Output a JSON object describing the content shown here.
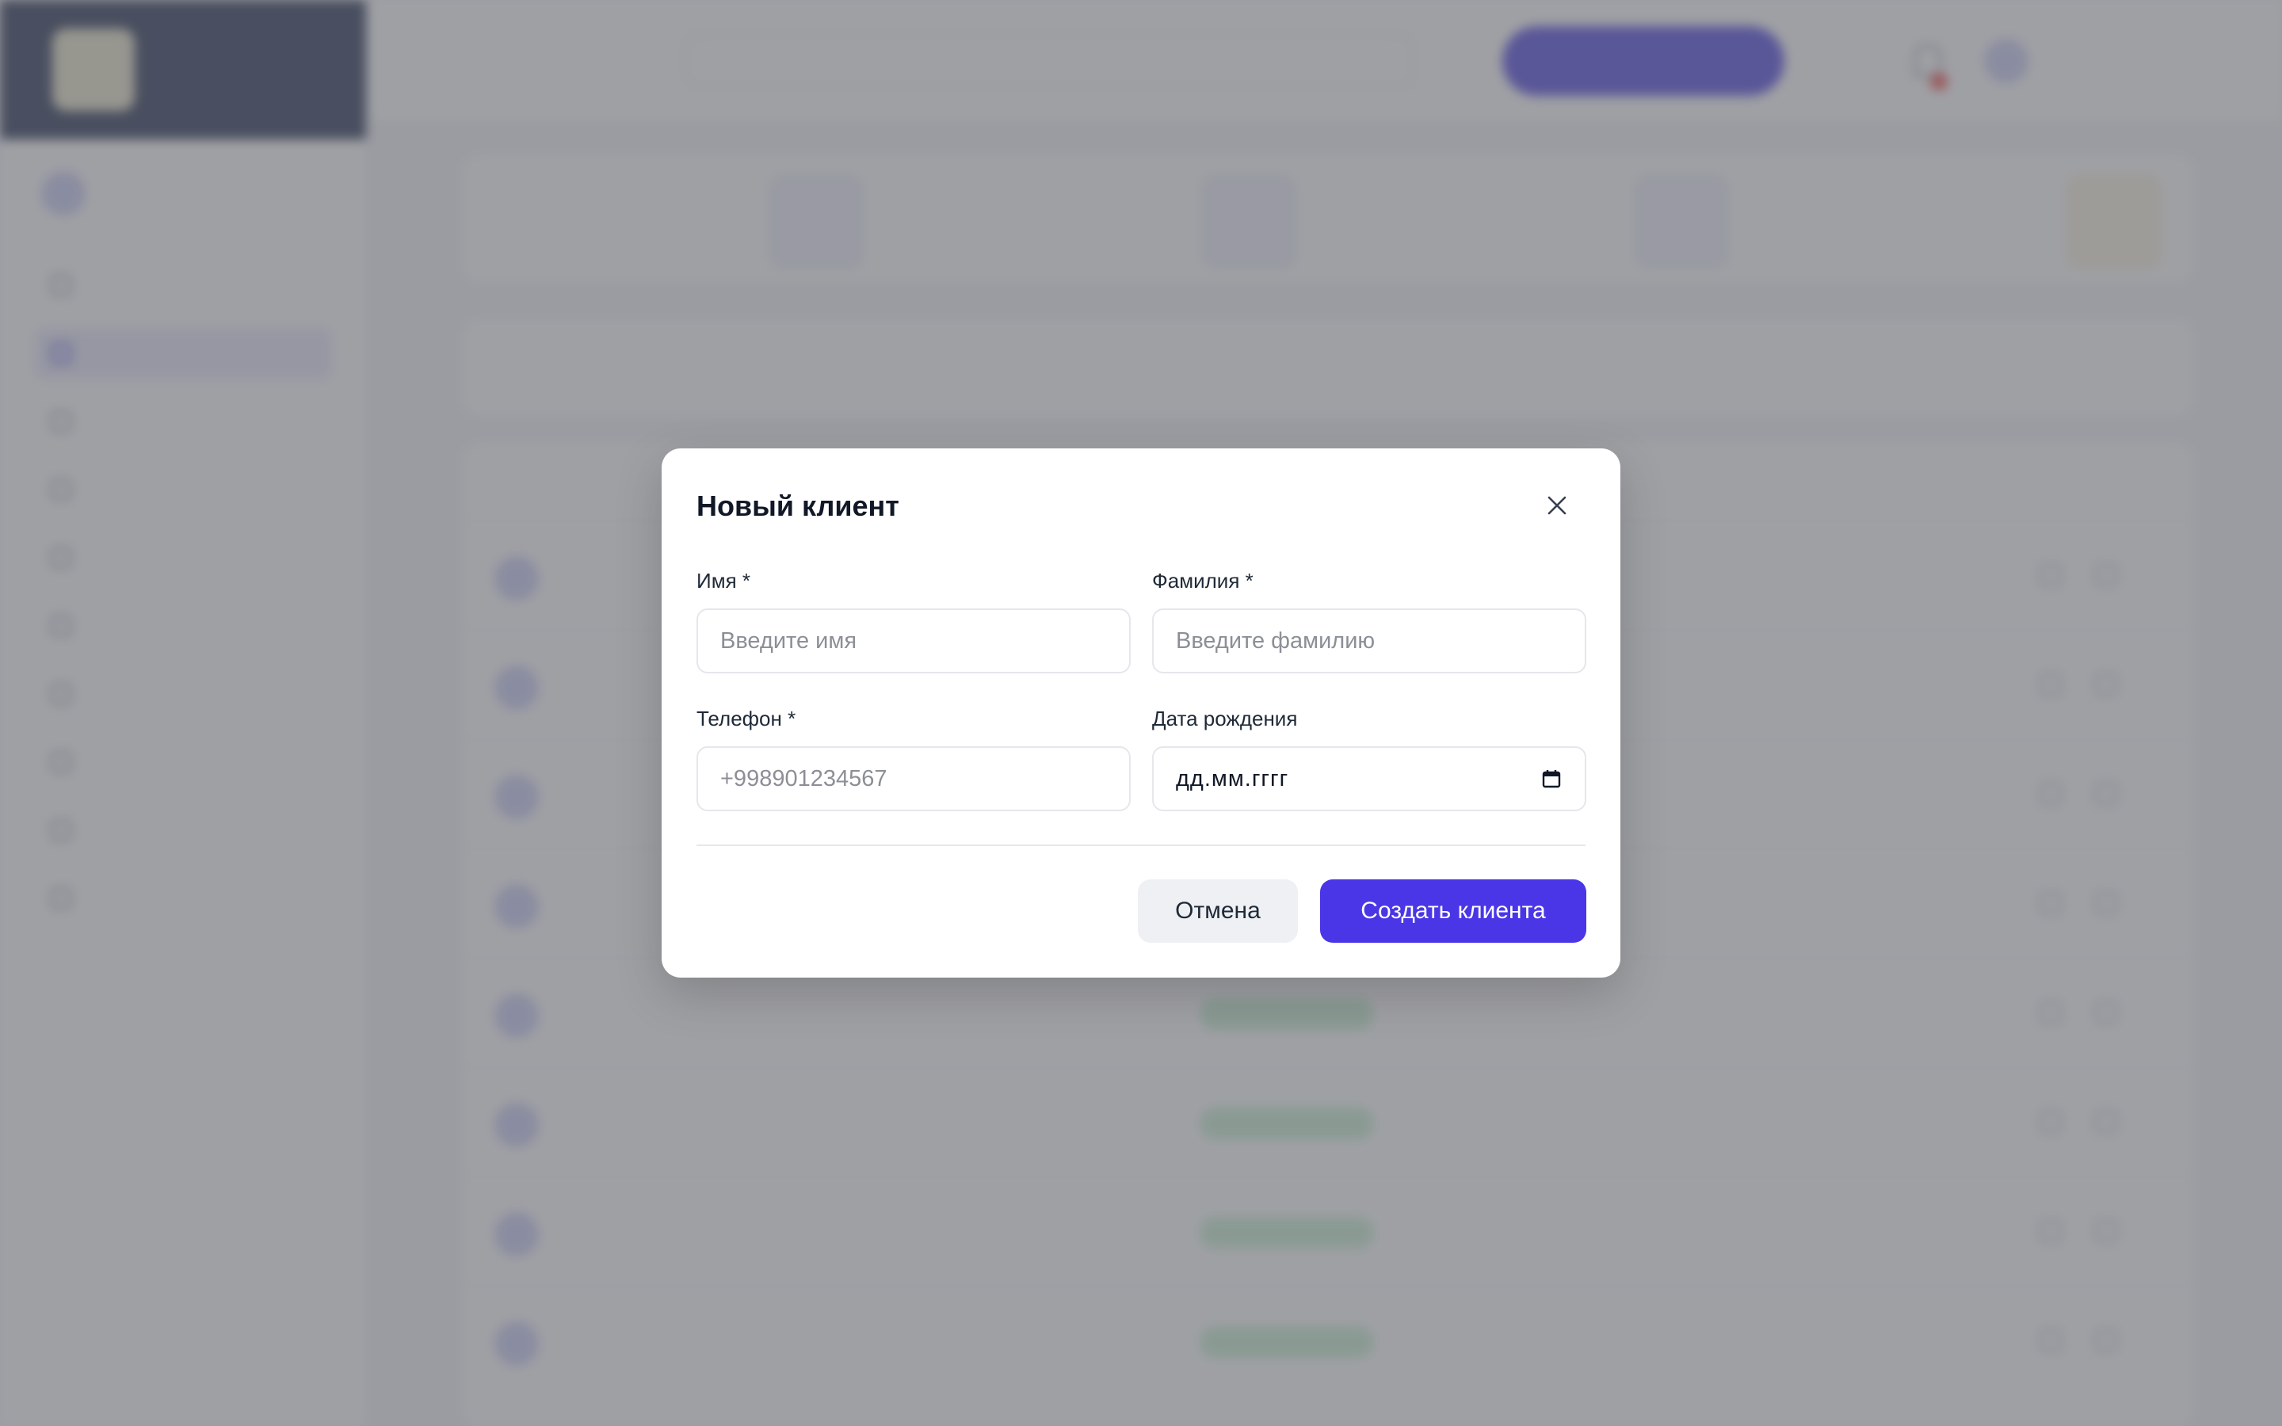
{
  "background": {
    "brand": {
      "name": "",
      "tagline": ""
    },
    "page_title": "",
    "search_placeholder": "",
    "add_button_label": "",
    "nav_items": [
      "",
      "",
      "",
      "",
      "",
      "",
      "",
      "",
      "",
      ""
    ],
    "active_nav_index": 1
  },
  "modal": {
    "title": "Новый клиент",
    "fields": {
      "first_name": {
        "label": "Имя *",
        "placeholder": "Введите имя",
        "value": ""
      },
      "last_name": {
        "label": "Фамилия *",
        "placeholder": "Введите фамилию",
        "value": ""
      },
      "phone": {
        "label": "Телефон *",
        "placeholder": "+998901234567",
        "value": ""
      },
      "birth_date": {
        "label": "Дата рождения",
        "placeholder": "дд.мм.гггг",
        "value": ""
      }
    },
    "buttons": {
      "cancel": "Отмена",
      "create": "Создать клиента"
    }
  },
  "icons": {
    "close": "close-icon",
    "calendar": "calendar-icon"
  },
  "colors": {
    "accent": "#4a36e6",
    "overlay": "#64666c",
    "sidebar_brand": "#1f2b4d"
  }
}
